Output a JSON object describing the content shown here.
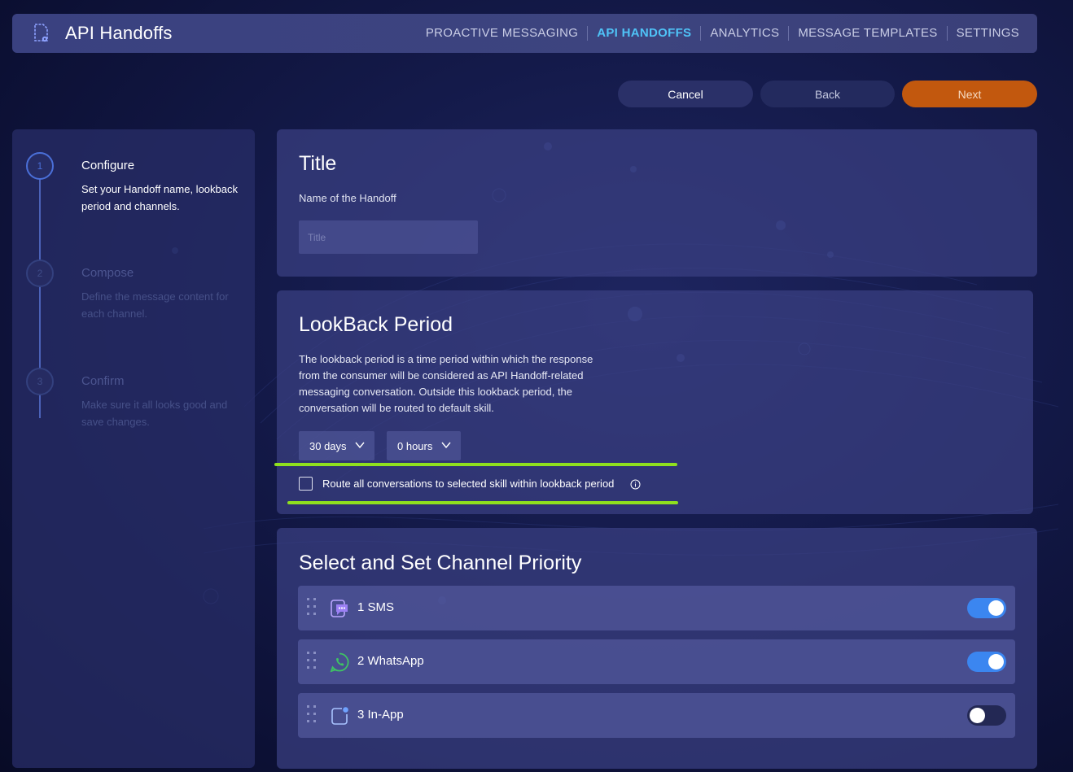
{
  "header": {
    "app_title": "API Handoffs",
    "nav": [
      {
        "label": "PROACTIVE MESSAGING",
        "active": false
      },
      {
        "label": "API HANDOFFS",
        "active": true
      },
      {
        "label": "ANALYTICS",
        "active": false
      },
      {
        "label": "MESSAGE TEMPLATES",
        "active": false
      },
      {
        "label": "SETTINGS",
        "active": false
      }
    ]
  },
  "actions": {
    "cancel_label": "Cancel",
    "back_label": "Back",
    "next_label": "Next"
  },
  "steps": [
    {
      "number": "1",
      "title": "Configure",
      "description": "Set your Handoff name, lookback period and channels.",
      "active": true
    },
    {
      "number": "2",
      "title": "Compose",
      "description": "Define the message content for each channel.",
      "active": false
    },
    {
      "number": "3",
      "title": "Confirm",
      "description": "Make sure it all looks good and save changes.",
      "active": false
    }
  ],
  "title_section": {
    "heading": "Title",
    "field_label": "Name of the Handoff",
    "input_value": "",
    "input_placeholder": "Title"
  },
  "lookback": {
    "heading": "LookBack Period",
    "description": "The lookback period is a time period within which the response from the consumer will be considered as API Handoff-related messaging conversation. Outside this lookback period, the conversation will be routed to default skill.",
    "days_value": "30 days",
    "hours_value": "0 hours",
    "route_all_label": "Route all conversations to selected skill within lookback period",
    "route_all_checked": false
  },
  "channels": {
    "heading": "Select and Set Channel Priority",
    "items": [
      {
        "label": "1 SMS",
        "icon": "sms-icon",
        "enabled": true
      },
      {
        "label": "2 WhatsApp",
        "icon": "whatsapp-icon",
        "enabled": true
      },
      {
        "label": "3 In-App",
        "icon": "in-app-icon",
        "enabled": false
      }
    ]
  },
  "colors": {
    "accent": "#4fc3f7",
    "next_button": "#c2580e",
    "toggle_on": "#3b86f0",
    "highlight": "#8fe01e"
  }
}
